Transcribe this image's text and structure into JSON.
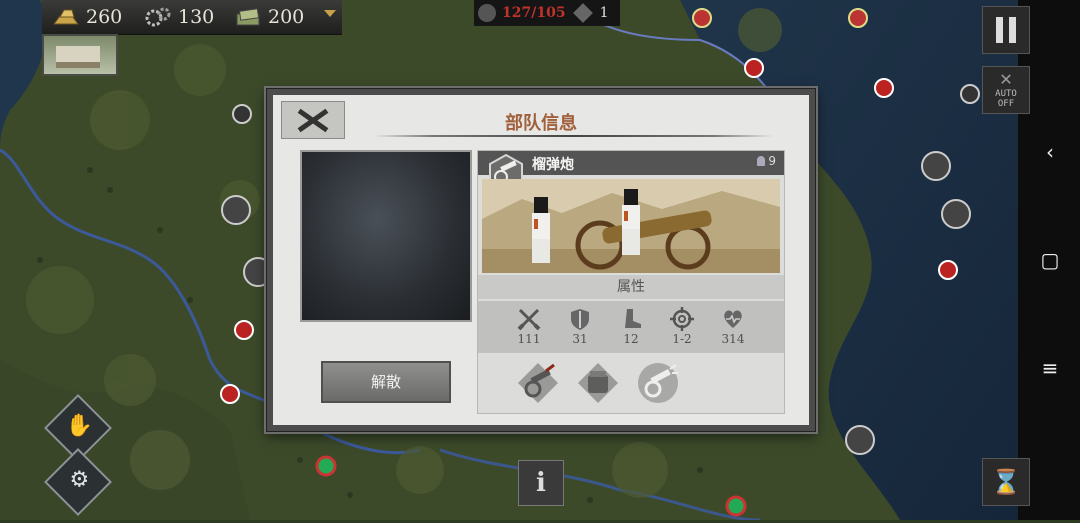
{
  "resources": {
    "gold": "260",
    "steel": "130",
    "money": "200",
    "icons": [
      "gold-bars-icon",
      "gears-icon",
      "cash-stack-icon"
    ]
  },
  "unit_counter": {
    "used": "127/105",
    "secondary": "1"
  },
  "controls": {
    "auto_label": "AUTO",
    "auto_state": "OFF"
  },
  "info_button_label": "i",
  "dialog": {
    "title": "部队信息",
    "disband_label": "解散",
    "unit": {
      "name": "榴弹炮",
      "count": "9",
      "attributes_label": "属性",
      "stats": [
        {
          "icon": "crossed-swords-icon",
          "value": "111"
        },
        {
          "icon": "shield-icon",
          "value": "31"
        },
        {
          "icon": "boot-icon",
          "value": "12"
        },
        {
          "icon": "crosshair-icon",
          "value": "1-2"
        },
        {
          "icon": "heart-icon",
          "value": "314"
        }
      ],
      "skills": [
        "cannon-skill-icon",
        "supply-skill-icon",
        "cannon-fire-skill-icon"
      ]
    }
  },
  "colors": {
    "title": "#a0603c",
    "counter_red": "#c0332b",
    "dialog_bg": "#e7e7e5"
  }
}
